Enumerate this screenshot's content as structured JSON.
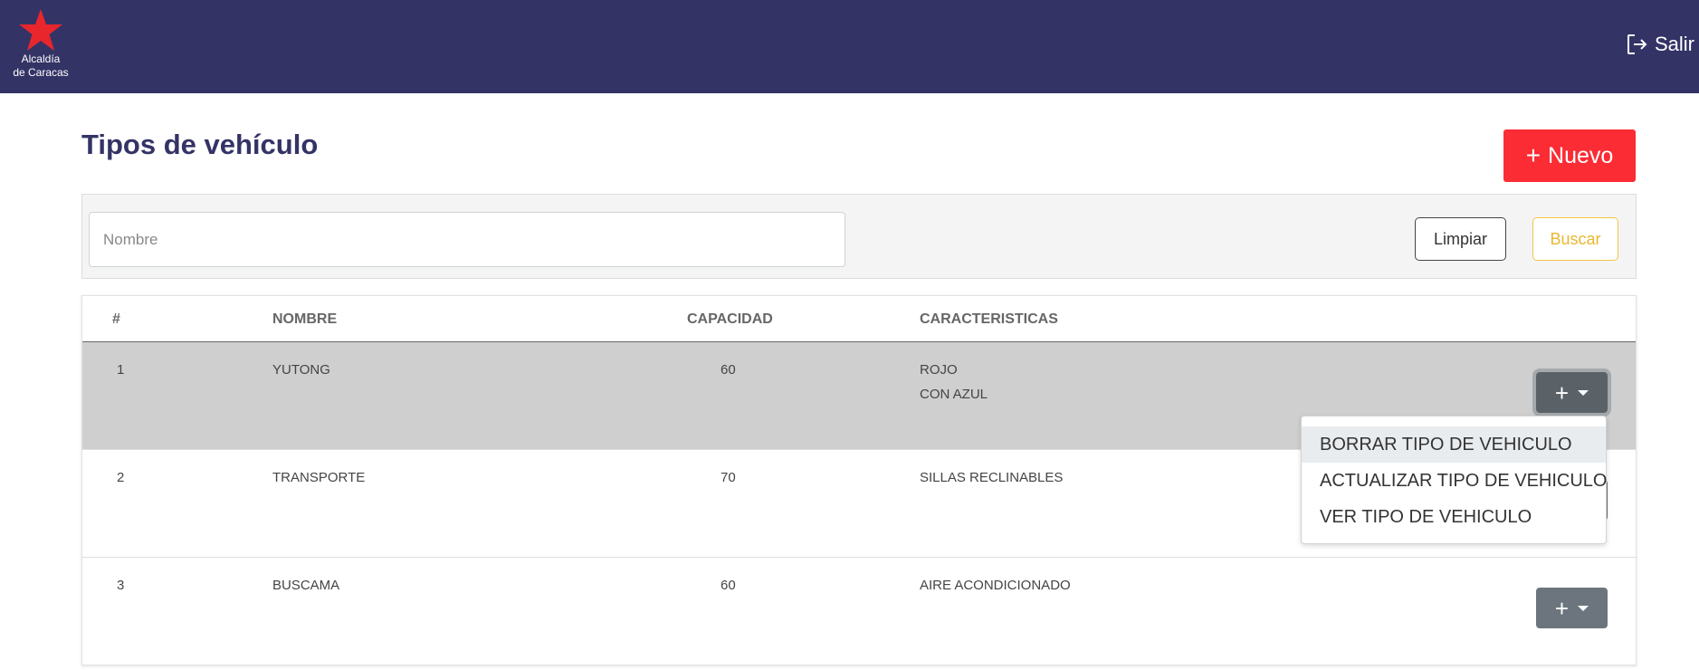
{
  "header": {
    "logo_line1": "Alcaldía",
    "logo_line2": "de Caracas",
    "logout_label": "Salir",
    "background": "#343366"
  },
  "page": {
    "title": "Tipos de vehículo",
    "new_button_label": "Nuevo"
  },
  "filters": {
    "name_placeholder": "Nombre",
    "name_value": "",
    "clear_label": "Limpiar",
    "search_label": "Buscar"
  },
  "table": {
    "columns": [
      "#",
      "NOMBRE",
      "CAPACIDAD",
      "CARACTERISTICAS"
    ],
    "rows": [
      {
        "id": "1",
        "nombre": "YUTONG",
        "capacidad": "60",
        "caracteristicas": [
          "ROJO",
          "CON AZUL"
        ]
      },
      {
        "id": "2",
        "nombre": "TRANSPORTE",
        "capacidad": "70",
        "caracteristicas": [
          "SILLAS RECLINABLES"
        ]
      },
      {
        "id": "3",
        "nombre": "BUSCAMA",
        "capacidad": "60",
        "caracteristicas": [
          "AIRE ACONDICIONADO"
        ]
      }
    ]
  },
  "dropdown": {
    "items": [
      "BORRAR TIPO DE VEHICULO",
      "ACTUALIZAR TIPO DE VEHICULO",
      "VER TIPO DE VEHICULO"
    ]
  },
  "colors": {
    "accent_red": "#fb2c34",
    "brand_navy": "#343366",
    "buscar_yellow": "#f2c648",
    "action_gray": "#6c757d"
  }
}
